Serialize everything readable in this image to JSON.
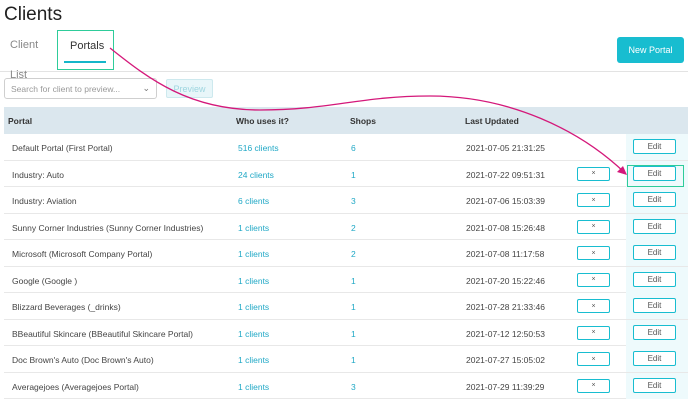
{
  "page": {
    "title": "Clients"
  },
  "tabs": [
    {
      "label": "Client List",
      "active": false
    },
    {
      "label": "Portals",
      "active": true
    }
  ],
  "toolbar": {
    "new_portal_label": "New Portal",
    "search_placeholder": "Search for client to preview...",
    "preview_label": "Preview"
  },
  "table": {
    "headers": {
      "portal": "Portal",
      "who": "Who uses it?",
      "shops": "Shops",
      "updated": "Last Updated"
    },
    "edit_label": "Edit",
    "delete_label": "×",
    "rows": [
      {
        "portal": "Default Portal (First Portal)",
        "who": "516 clients",
        "shops": "6",
        "updated": "2021-07-05 21:31:25",
        "deletable": false
      },
      {
        "portal": "Industry: Auto",
        "who": "24 clients",
        "shops": "1",
        "updated": "2021-07-22 09:51:31",
        "deletable": true
      },
      {
        "portal": "Industry: Aviation",
        "who": "6 clients",
        "shops": "3",
        "updated": "2021-07-06 15:03:39",
        "deletable": true
      },
      {
        "portal": "Sunny Corner Industries (Sunny Corner Industries)",
        "who": "1 clients",
        "shops": "2",
        "updated": "2021-07-08 15:26:48",
        "deletable": true
      },
      {
        "portal": "Microsoft (Microsoft Company Portal)",
        "who": "1 clients",
        "shops": "2",
        "updated": "2021-07-08 11:17:58",
        "deletable": true
      },
      {
        "portal": "Google (Google )",
        "who": "1 clients",
        "shops": "1",
        "updated": "2021-07-20 15:22:46",
        "deletable": true
      },
      {
        "portal": "Blizzard Beverages (_drinks)",
        "who": "1 clients",
        "shops": "1",
        "updated": "2021-07-28 21:33:46",
        "deletable": true
      },
      {
        "portal": "BBeautiful Skincare (BBeautiful Skincare Portal)",
        "who": "1 clients",
        "shops": "1",
        "updated": "2021-07-12 12:50:53",
        "deletable": true
      },
      {
        "portal": "Doc Brown's Auto (Doc Brown's Auto)",
        "who": "1 clients",
        "shops": "1",
        "updated": "2021-07-27 15:05:02",
        "deletable": true
      },
      {
        "portal": "Averagejoes (Averagejoes Portal)",
        "who": "1 clients",
        "shops": "3",
        "updated": "2021-07-29 11:39:29",
        "deletable": true
      }
    ]
  },
  "colors": {
    "accent": "#18bdd0",
    "highlight": "#2ecc9a",
    "arrow": "#d4187a"
  },
  "icons": {
    "select_chevron": "chevron-down-icon"
  }
}
